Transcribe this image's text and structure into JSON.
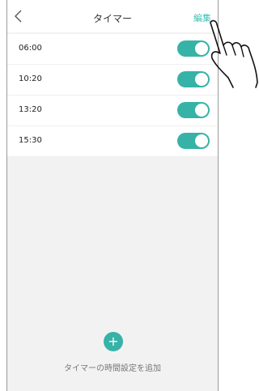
{
  "navbar": {
    "back_icon": "chevron-left-icon",
    "title": "タイマー",
    "edit_label": "編集"
  },
  "timers": [
    {
      "time": "06:00",
      "enabled": true
    },
    {
      "time": "10:20",
      "enabled": true
    },
    {
      "time": "13:20",
      "enabled": true
    },
    {
      "time": "15:30",
      "enabled": true
    }
  ],
  "add": {
    "icon_glyph": "+",
    "label": "タイマーの時間設定を追加"
  },
  "colors": {
    "accent": "#36b3a6",
    "edit_text": "#3cc0b4",
    "background": "#f2f2f2"
  }
}
